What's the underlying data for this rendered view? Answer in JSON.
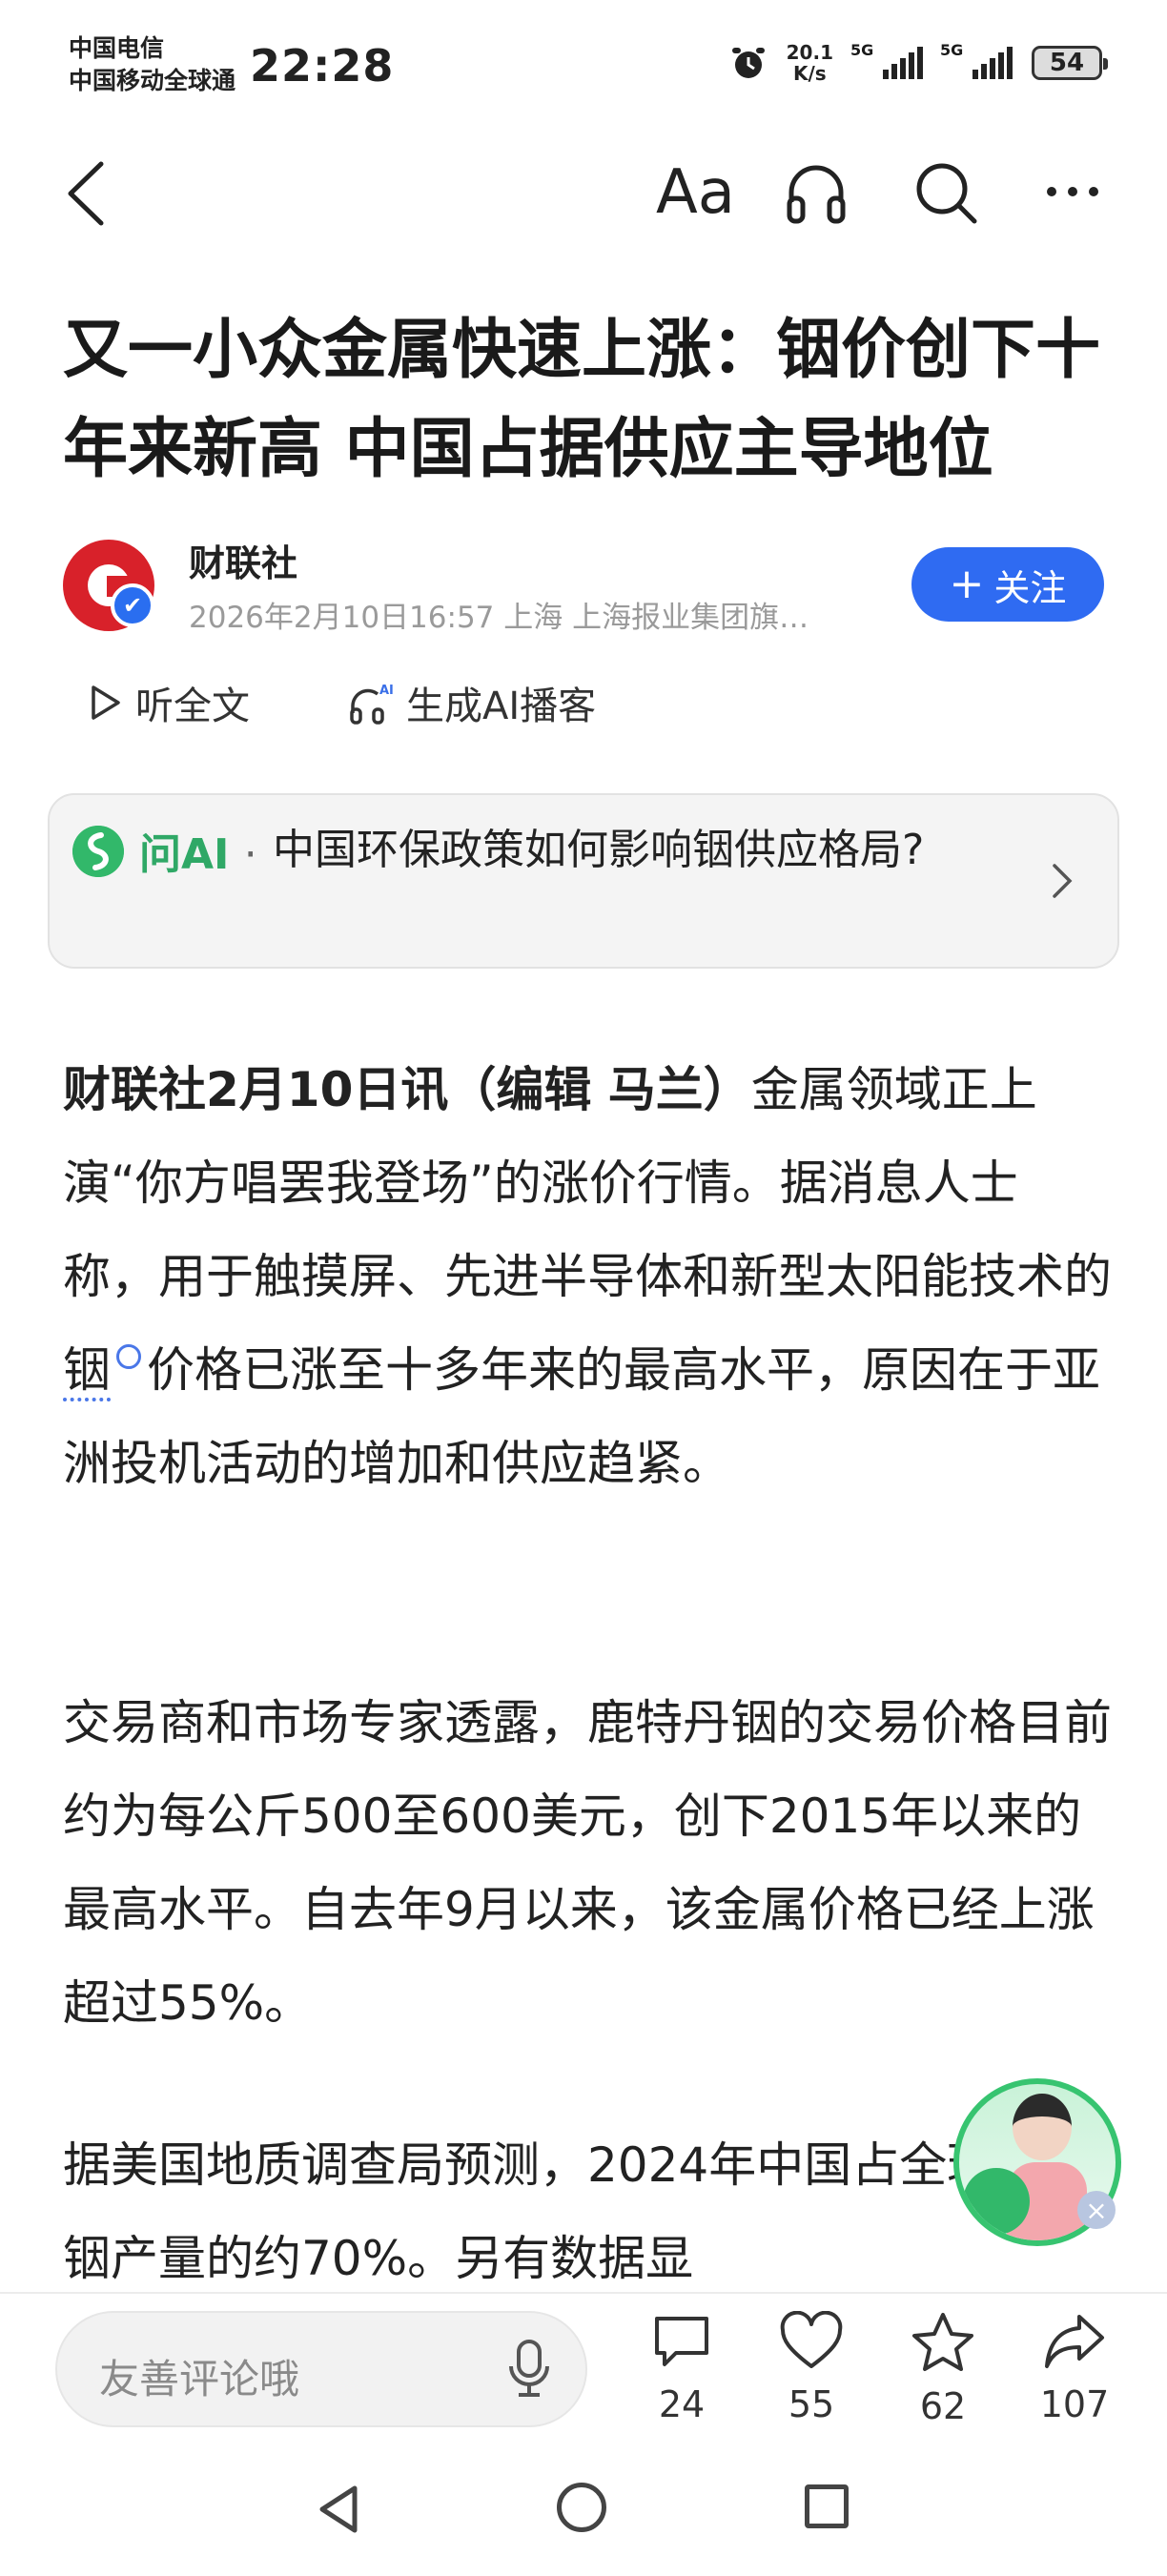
{
  "status_bar": {
    "carrier_1": "中国电信",
    "carrier_2": "中国移动全球通",
    "time": "22:28",
    "net_speed_value": "20.1",
    "net_speed_unit": "K/s",
    "signal_1_tag": "5G",
    "signal_2_tag": "5G",
    "battery": "54"
  },
  "nav": {
    "font_size_label": "Aa",
    "icons": [
      "back-icon",
      "font-size-icon",
      "headphone-icon",
      "search-icon",
      "more-icon"
    ]
  },
  "article": {
    "title": "又一小众金属快速上涨：铟价创下十年来新高 中国占据供应主导地位",
    "author": {
      "name": "财联社",
      "meta": "2026年2月10日16:57 上海 上海报业集团旗…",
      "follow_label": "关注"
    },
    "listen_label": "听全文",
    "podcast_label": "生成AI播客",
    "ask_ai": {
      "label": "问AI",
      "separator": "·",
      "question": "中国环保政策如何影响铟供应格局?"
    },
    "paragraphs": {
      "p1_lead": "财联社2月10日讯（编辑 马兰）",
      "p1_before_link": "金属领域正上演“你方唱罢我登场”的涨价行情。据消息人士称，用于触摸屏、先进半导体和新型太阳能技术的",
      "p1_link": "铟",
      "p1_after_link": "价格已涨至十多年来的最高水平，原因在于亚洲投机活动的增加和供应趋紧。",
      "p2": "交易商和市场专家透露，鹿特丹铟的交易价格目前约为每公斤500至600美元，创下2015年以来的最高水平。自去年9月以来，该金属价格已经上涨超过55%。",
      "p3": "据美国地质调查局预测，2024年中国占全球精炼铟产量的约70%。另有数据显"
    }
  },
  "bottom_bar": {
    "comment_placeholder": "友善评论哦",
    "comments_count": "24",
    "likes_count": "55",
    "favorites_count": "62",
    "shares_count": "107"
  },
  "colors": {
    "accent_blue": "#2f6bf2",
    "ai_green": "#2fa866",
    "brand_red": "#d8212a"
  }
}
